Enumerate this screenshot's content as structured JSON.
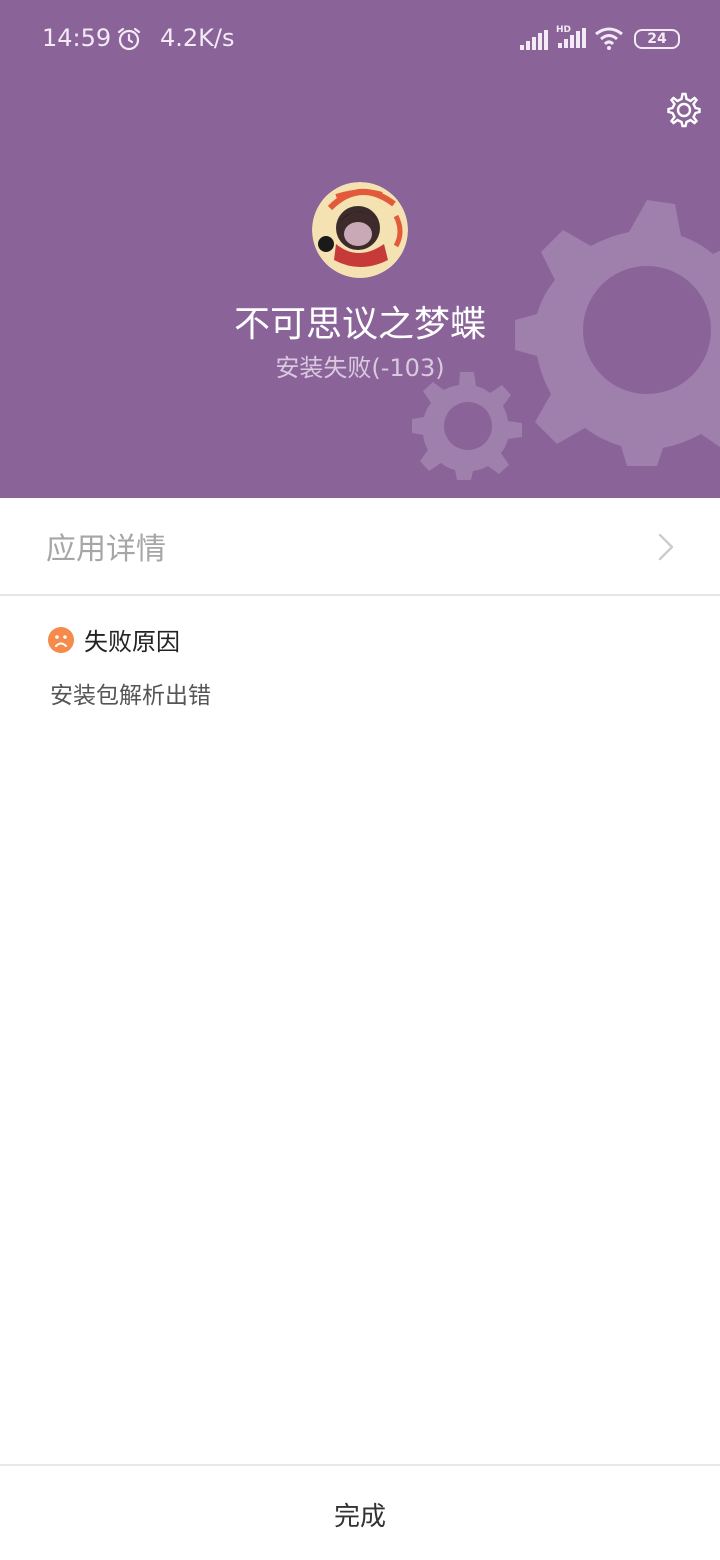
{
  "status_bar": {
    "time": "14:59",
    "net_speed": "4.2K/s",
    "battery": "24",
    "icons": [
      "alarm-icon",
      "signal-icon",
      "hd-signal-icon",
      "wifi-icon",
      "battery-icon"
    ]
  },
  "header": {
    "app_name": "不可思议之梦蝶",
    "install_status": "安装失败(-103)",
    "settings_icon": "gear-icon",
    "bg_color": "#8a6399"
  },
  "details": {
    "label": "应用详情"
  },
  "failure": {
    "title": "失败原因",
    "reason": "安装包解析出错",
    "icon": "sad-face-icon",
    "icon_color": "#f58a4b"
  },
  "footer": {
    "done_label": "完成"
  }
}
